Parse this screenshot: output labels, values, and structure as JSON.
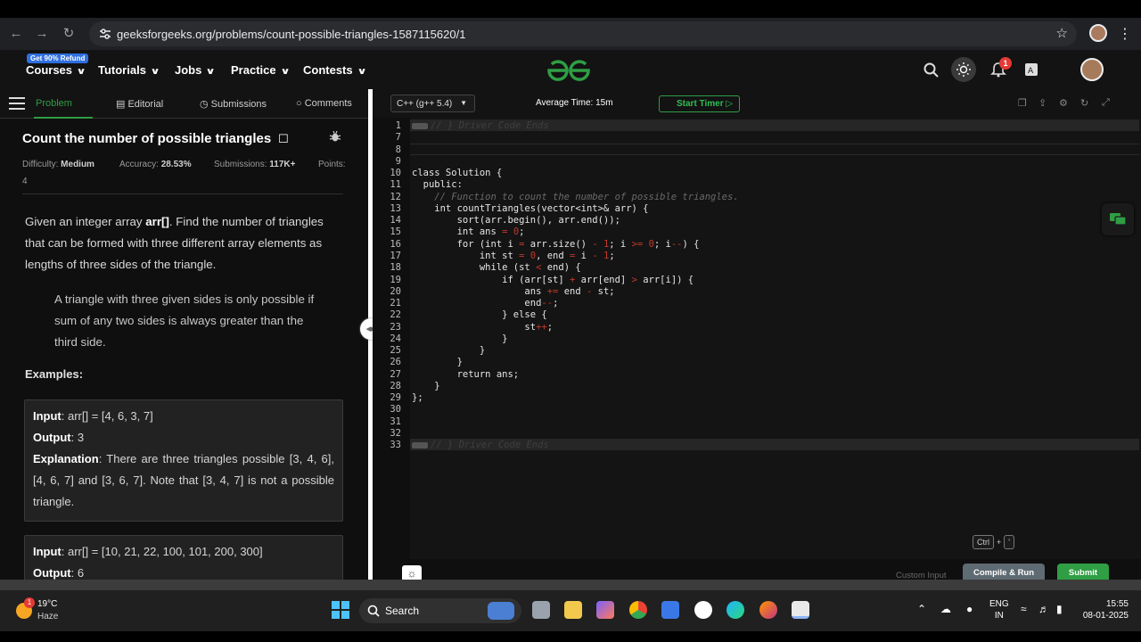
{
  "browser": {
    "url": "geeksforgeeks.org/problems/count-possible-triangles-1587115620/1"
  },
  "header": {
    "refund_badge": "Get 90% Refund",
    "menu": [
      "Courses",
      "Tutorials",
      "Jobs",
      "Practice",
      "Contests"
    ],
    "logo": "GfG",
    "notification_count": "1"
  },
  "problem": {
    "tabs": [
      "Problem",
      "Editorial",
      "Submissions",
      "Comments"
    ],
    "title": "Count the number of possible triangles",
    "difficulty_label": "Difficulty:",
    "difficulty": "Medium",
    "accuracy_label": "Accuracy:",
    "accuracy": "28.53%",
    "submissions_label": "Submissions:",
    "submissions": "117K+",
    "points_label": "Points:",
    "points": "4",
    "desc_1": "Given an integer array ",
    "desc_arr": "arr[]",
    "desc_2": ". Find the number of triangles that can be formed with three different array elements as lengths of three sides of the triangle.",
    "note": "A triangle with three given sides is only possible if sum of any two sides is always greater than the third side.",
    "examples_heading": "Examples:",
    "input_label": "Input",
    "output_label": "Output",
    "explanation_label": "Explanation",
    "ex1_input": ": arr[] = [4, 6, 3, 7]",
    "ex1_output": ": 3",
    "ex1_explanation": ": There are three triangles possible [3, 4, 6], [4, 6, 7] and [3, 6, 7]. Note that [3, 4, 7] is not a possible triangle.",
    "ex2_input": ": arr[] = [10, 21, 22, 100, 101, 200, 300]",
    "ex2_output": ": 6"
  },
  "editor": {
    "language": "C++ (g++ 5.4)",
    "avg_time": "Average Time: 15m",
    "start_timer": "Start Timer",
    "line_numbers": [
      "1",
      "7",
      "8",
      "9",
      "10",
      "11",
      "12",
      "13",
      "14",
      "15",
      "16",
      "17",
      "18",
      "19",
      "20",
      "21",
      "22",
      "23",
      "24",
      "25",
      "26",
      "27",
      "28",
      "29",
      "30",
      "31",
      "32",
      "33"
    ],
    "fold_text": "// } Driver Code Ends",
    "code": [
      "class Solution {",
      "  public:",
      "    // Function to count the number of possible triangles.",
      "    int countTriangles(vector<int>& arr) {",
      "        sort(arr.begin(), arr.end());",
      "        int ans = 0;",
      "        for (int i = arr.size() - 1; i >= 0; i--) {",
      "            int st = 0, end = i - 1;",
      "            while (st < end) {",
      "                if (arr[st] + arr[end] > arr[i]) {",
      "                    ans += end - st;",
      "                    end--;",
      "                } else {",
      "                    st++;",
      "                }",
      "            }",
      "        }",
      "        return ans;",
      "    }",
      "};"
    ],
    "shortcut_ctrl": "Ctrl",
    "shortcut_plus": "+",
    "shortcut_key": "'",
    "custom_input": "Custom Input",
    "compile_run": "Compile & Run",
    "submit": "Submit"
  },
  "taskbar": {
    "weather_badge": "1",
    "temp": "19°C",
    "weather": "Haze",
    "search": "Search",
    "lang_1": "ENG",
    "lang_2": "IN",
    "time": "15:55",
    "date": "08-01-2025"
  },
  "colors": {
    "accent_green": "#2f9e44",
    "editor_bg": "#141414",
    "panel_bg": "#0f0f0f"
  }
}
